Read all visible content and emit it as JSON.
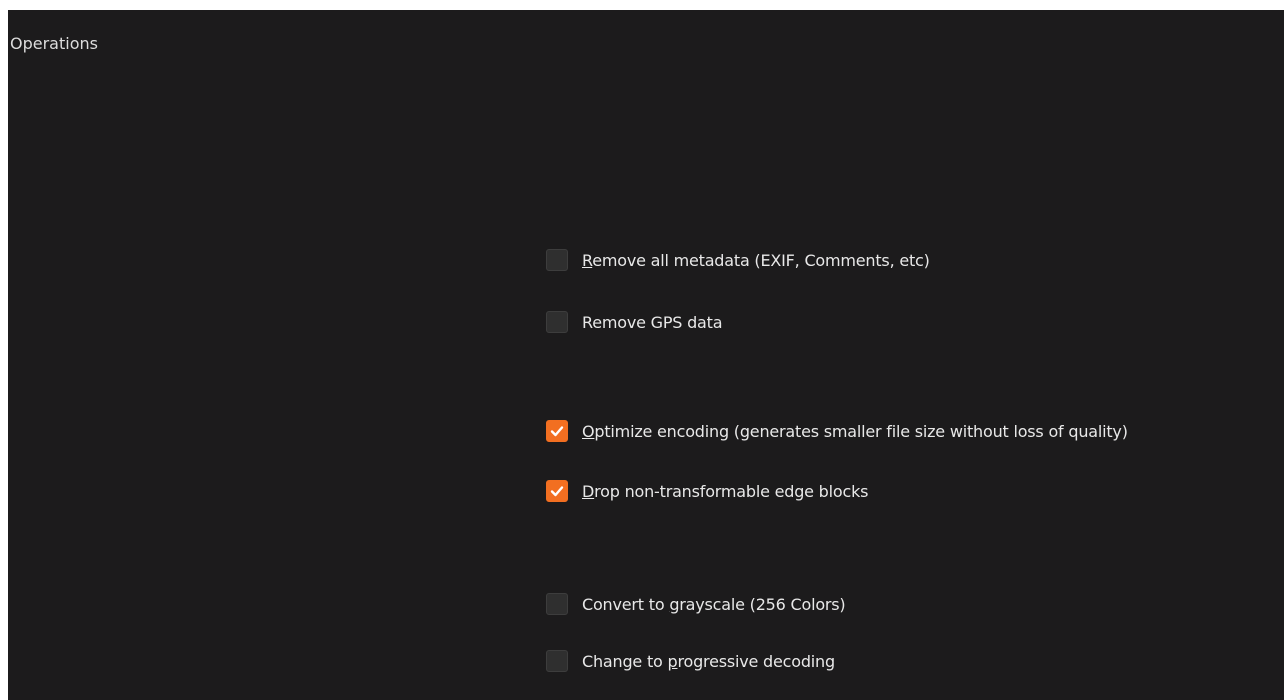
{
  "section": {
    "title": "Operations"
  },
  "options": [
    {
      "label_mnemonic": "R",
      "label_rest": "emove all metadata (EXIF, Comments, etc)",
      "checked": false
    },
    {
      "label_pre": "Remove GPS data",
      "checked": false
    },
    {
      "label_mnemonic": "O",
      "label_rest": "ptimize encoding (generates smaller file size without loss of quality)",
      "checked": true
    },
    {
      "label_mnemonic": "D",
      "label_rest": "rop non-transformable edge blocks",
      "checked": true
    },
    {
      "label_pre": "Convert to ",
      "label_mnemonic": "g",
      "label_rest": "rayscale (256 Colors)",
      "checked": false
    },
    {
      "label_pre": "Change to ",
      "label_mnemonic": "p",
      "label_rest": "rogressive decoding",
      "checked": false
    }
  ],
  "colors": {
    "background": "#1c1b1c",
    "checkbox_checked": "#f26f21",
    "checkbox_unchecked": "#2f2f2f",
    "text": "#e8e8e8"
  }
}
